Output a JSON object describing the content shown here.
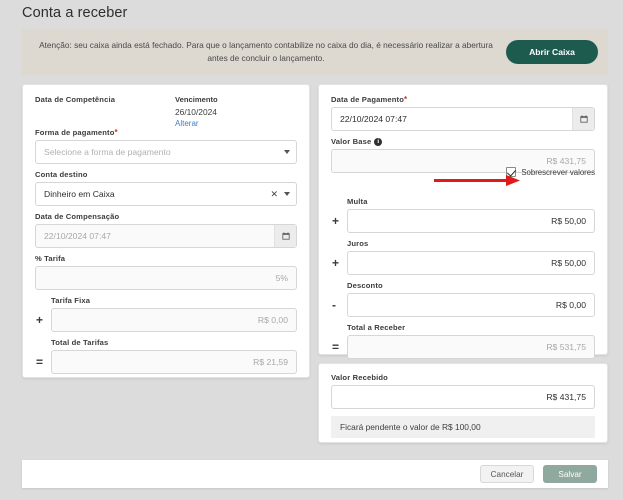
{
  "header": {
    "title": "Conta a receber"
  },
  "banner": {
    "text": "Atenção: seu caixa ainda está fechado. Para que o lançamento contabilize no caixa do dia, é necessário realizar a abertura antes de concluir o lançamento.",
    "button_label": "Abrir Caixa",
    "bg_color": "#ddd8d0",
    "button_color": "#1d5b4f"
  },
  "left_card": {
    "competencia_label": "Data de Competência",
    "vencimento": {
      "label": "Vencimento",
      "date": "26/10/2024",
      "change_link": "Alterar",
      "link_color": "#3f7fc1"
    },
    "forma_pagamento": {
      "label": "Forma de pagamento",
      "required": "*",
      "placeholder": "Selecione a forma de pagamento",
      "value": ""
    },
    "conta_destino": {
      "label": "Conta destino",
      "value": "Dinheiro em Caixa",
      "clear_icon": "✕"
    },
    "data_compensacao": {
      "label": "Data de Compensação",
      "value": "22/10/2024 07:47",
      "calendar_icon": "calendar-icon"
    },
    "pct_tarifa": {
      "label": "% Tarifa",
      "value": "5%"
    },
    "tarifa_fixa": {
      "label": "Tarifa Fixa",
      "operator": "+",
      "value": "R$ 0,00"
    },
    "total_tarifas": {
      "label": "Total de Tarifas",
      "operator": "=",
      "value": "R$ 21,59"
    }
  },
  "right_card": {
    "data_pagamento": {
      "label": "Data de Pagamento",
      "required": "*",
      "value": "22/10/2024 07:47",
      "calendar_icon": "calendar-icon"
    },
    "valor_base": {
      "label": "Valor Base",
      "info_icon": "i",
      "value": "R$ 431,75"
    },
    "sobrescrever": {
      "label": "Sobrescrever valores",
      "checked": true
    },
    "multa": {
      "label": "Multa",
      "operator": "+",
      "value": "R$ 50,00"
    },
    "juros": {
      "label": "Juros",
      "operator": "+",
      "value": "R$ 50,00"
    },
    "desconto": {
      "label": "Desconto",
      "operator": "-",
      "value": "R$ 0,00"
    },
    "total_receber": {
      "label": "Total a Receber",
      "operator": "=",
      "value": "R$ 531,75"
    }
  },
  "received_card": {
    "valor_recebido": {
      "label": "Valor Recebido",
      "value": "R$ 431,75"
    },
    "pending_note": "Ficará pendente o valor de R$ 100,00"
  },
  "footer": {
    "cancel_label": "Cancelar",
    "save_label": "Salvar",
    "save_color": "#8fa99f"
  }
}
